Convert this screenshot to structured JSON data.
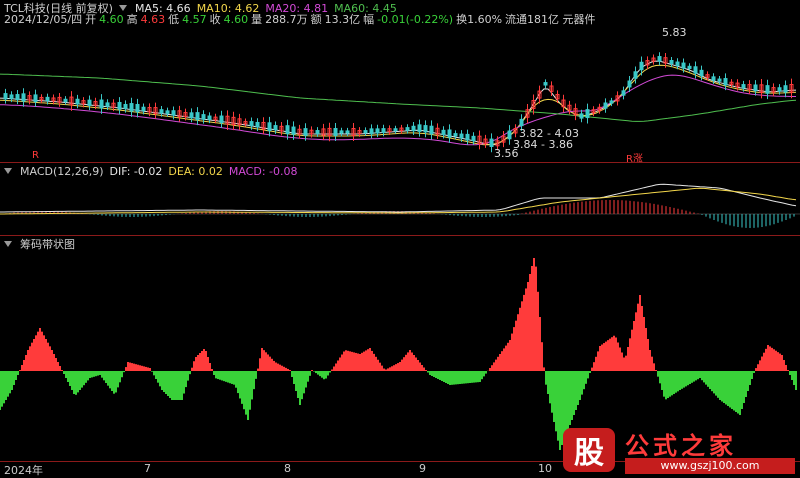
{
  "header": {
    "stock_title": "TCL科技(日线 前复权)",
    "ma5": "MA5: 4.66",
    "ma10": "MA10: 4.62",
    "ma20": "MA20: 4.81",
    "ma60": "MA60: 4.45"
  },
  "quote": {
    "date": "2024/12/05/四",
    "open_label": "开",
    "open": "4.60",
    "high_label": "高",
    "high": "4.63",
    "low_label": "低",
    "low": "4.57",
    "close_label": "收",
    "close": "4.60",
    "volume_label": "量",
    "volume": "288.7万",
    "amount_label": "额",
    "amount": "13.3亿",
    "change_label": "幅",
    "change": "-0.01(-0.22%)",
    "turnover": "换1.60%",
    "float": "流通181亿 元器件"
  },
  "annotations": {
    "peak": "5.83",
    "low1": "3.56",
    "range1": "3.84 - 3.86",
    "range2": "3.82 - 4.03",
    "marker_left": "R",
    "marker_right": "R涨"
  },
  "macd": {
    "title": "MACD(12,26,9)",
    "dif": "DIF: -0.02",
    "dea": "DEA: 0.02",
    "macd": "MACD: -0.08"
  },
  "chip": {
    "title": "筹码带状图"
  },
  "xaxis": {
    "labels": [
      "2024年",
      "7",
      "8",
      "9",
      "10"
    ]
  },
  "watermark": {
    "badge": "股",
    "name": "公式之家",
    "url": "www.gszj100.com"
  },
  "colors": {
    "up": "#ff3b3b",
    "down": "#39d139",
    "ma5": "#e6e6e6",
    "ma10": "#f2d64b",
    "ma20": "#d24ad6",
    "ma60": "#4fbf4f",
    "separator": "#8b1a1a"
  }
}
